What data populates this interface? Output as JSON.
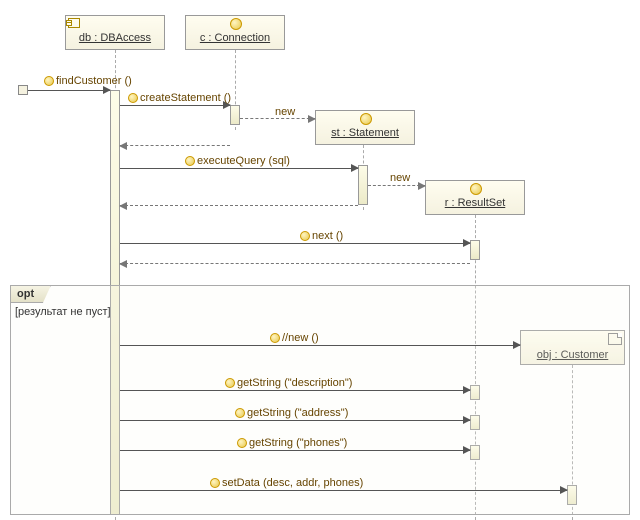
{
  "lifelines": {
    "db": "db : DBAccess",
    "c": "c : Connection",
    "st": "st : Statement",
    "r": "r : ResultSet",
    "obj": "obj : Customer"
  },
  "messages": {
    "find": "findCustomer ()",
    "createStmt": "createStatement ()",
    "new1": "new",
    "execQuery": "executeQuery (sql)",
    "new2": "new",
    "next": "next ()",
    "newObj": "//new ()",
    "getDesc": "getString (\"description\")",
    "getAddr": "getString (\"address\")",
    "getPhones": "getString (\"phones\")",
    "setData": "setData (desc, addr, phones)"
  },
  "frame": {
    "label": "opt",
    "guard": "[результат не пуст]"
  },
  "chart_data": {
    "type": "sequence-diagram",
    "lifelines": [
      {
        "id": "db",
        "name": "db : DBAccess",
        "stereotype": "component"
      },
      {
        "id": "c",
        "name": "c : Connection",
        "stereotype": "interface"
      },
      {
        "id": "st",
        "name": "st : Statement",
        "stereotype": "interface",
        "created_by": "createStatement"
      },
      {
        "id": "r",
        "name": "r : ResultSet",
        "stereotype": "interface",
        "created_by": "executeQuery"
      },
      {
        "id": "obj",
        "name": "obj : Customer",
        "stereotype": "object",
        "created_by": "//new"
      }
    ],
    "messages": [
      {
        "from": "external",
        "to": "db",
        "label": "findCustomer ()",
        "kind": "sync"
      },
      {
        "from": "db",
        "to": "c",
        "label": "createStatement ()",
        "kind": "sync"
      },
      {
        "from": "c",
        "to": "st",
        "label": "new",
        "kind": "create"
      },
      {
        "from": "c",
        "to": "db",
        "label": "",
        "kind": "return"
      },
      {
        "from": "db",
        "to": "st",
        "label": "executeQuery (sql)",
        "kind": "sync"
      },
      {
        "from": "st",
        "to": "r",
        "label": "new",
        "kind": "create"
      },
      {
        "from": "st",
        "to": "db",
        "label": "",
        "kind": "return"
      },
      {
        "from": "db",
        "to": "r",
        "label": "next ()",
        "kind": "sync"
      },
      {
        "from": "r",
        "to": "db",
        "label": "",
        "kind": "return"
      },
      {
        "from": "db",
        "to": "obj",
        "label": "//new ()",
        "kind": "create",
        "in_fragment": "opt"
      },
      {
        "from": "db",
        "to": "r",
        "label": "getString (\"description\")",
        "kind": "sync",
        "in_fragment": "opt"
      },
      {
        "from": "db",
        "to": "r",
        "label": "getString (\"address\")",
        "kind": "sync",
        "in_fragment": "opt"
      },
      {
        "from": "db",
        "to": "r",
        "label": "getString (\"phones\")",
        "kind": "sync",
        "in_fragment": "opt"
      },
      {
        "from": "db",
        "to": "obj",
        "label": "setData (desc, addr, phones)",
        "kind": "sync",
        "in_fragment": "opt"
      }
    ],
    "fragments": [
      {
        "id": "opt",
        "type": "opt",
        "guard": "[результат не пуст]"
      }
    ]
  }
}
